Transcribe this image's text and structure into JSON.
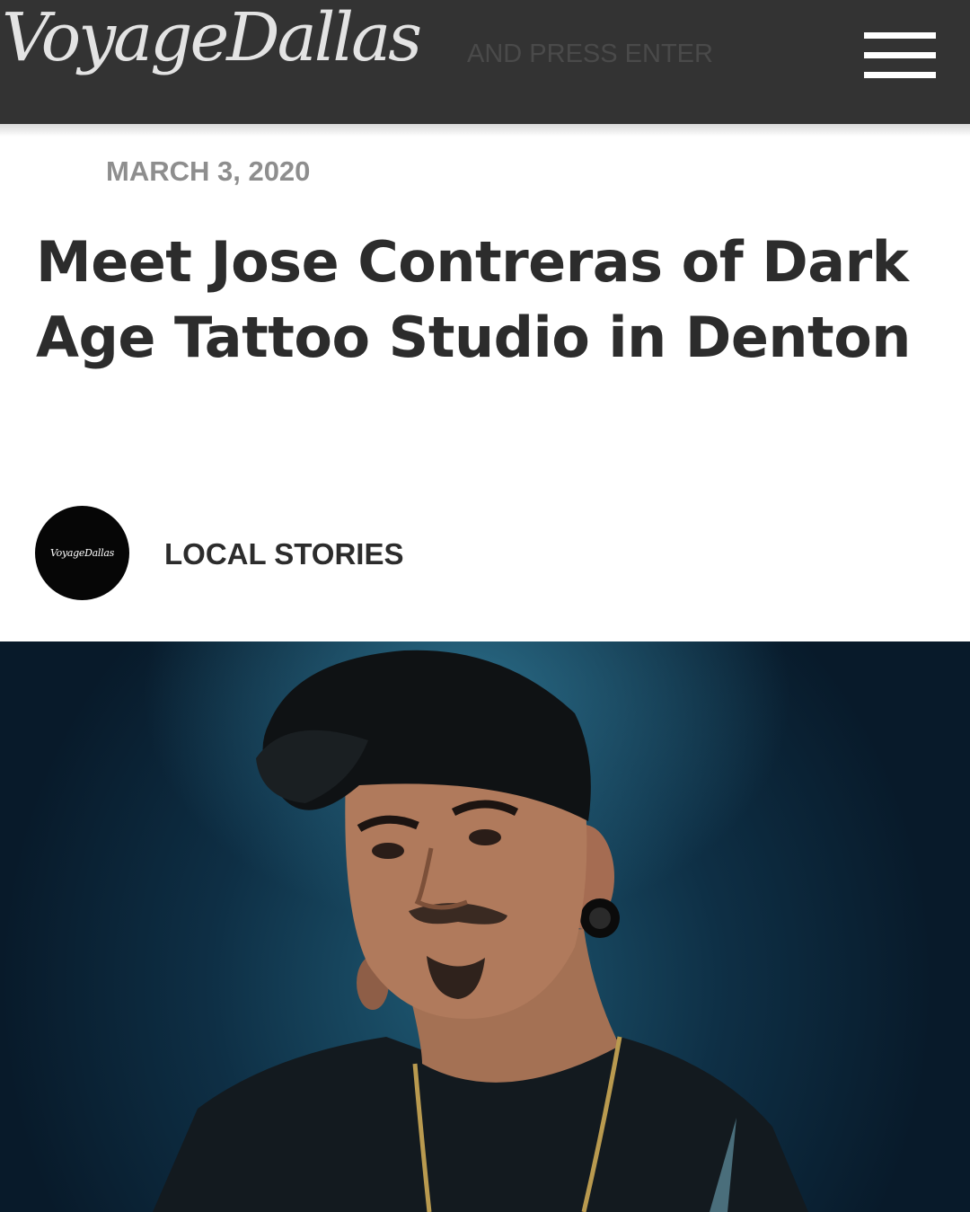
{
  "header": {
    "logo_text": "VoyageDallas",
    "search_hint": "AND PRESS ENTER",
    "menu_icon": "hamburger-icon",
    "background": "#333333"
  },
  "article": {
    "date": "MARCH 3, 2020",
    "title": "Meet Jose Contreras of Dark Age Tattoo Studio in Denton",
    "author_avatar_text": "VoyageDallas",
    "category": "LOCAL STORIES"
  },
  "hero_image": {
    "subject": "portrait-photo",
    "background_color": "#1b4f6a"
  }
}
